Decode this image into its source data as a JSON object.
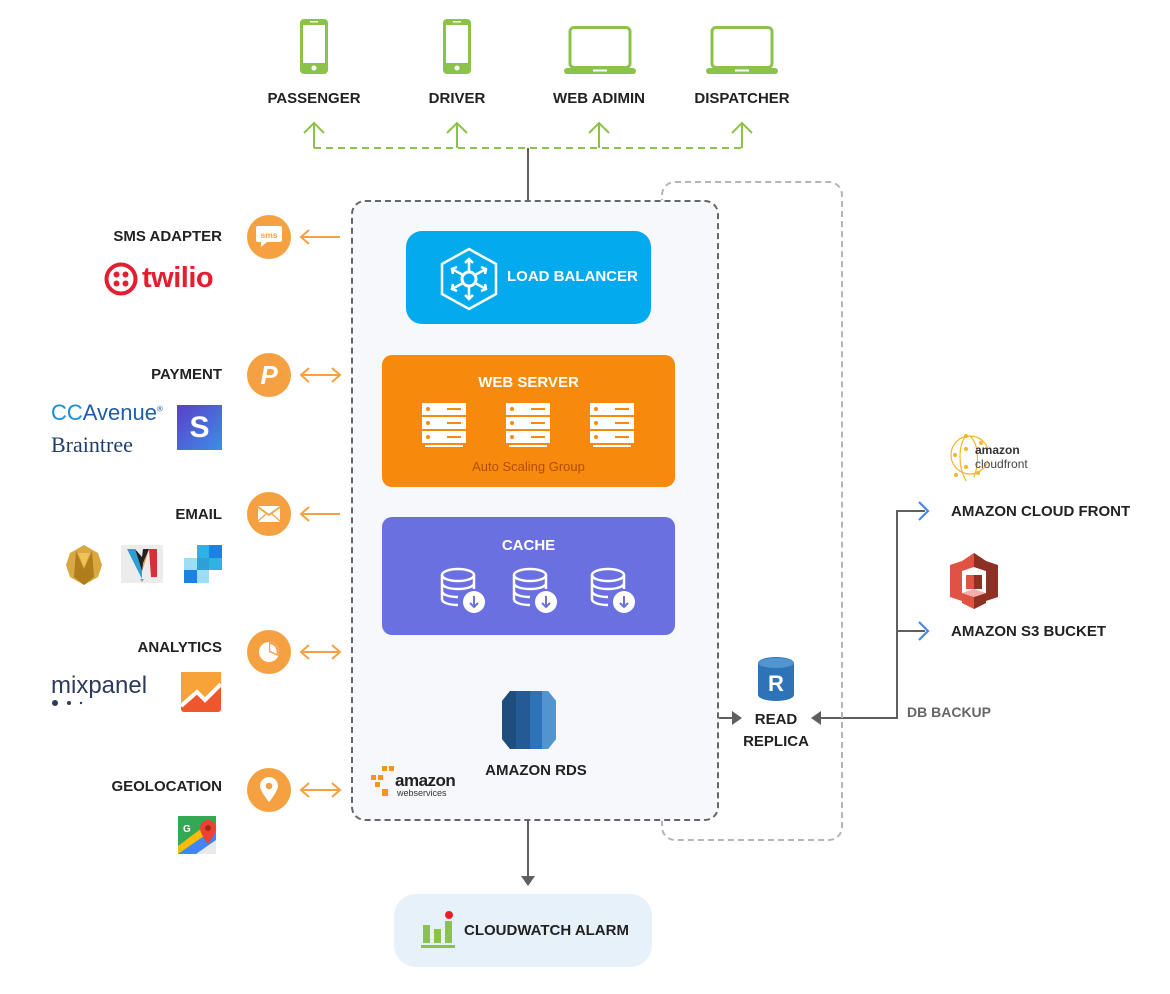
{
  "clients": [
    {
      "label": "PASSENGER",
      "icon": "smartphone-icon"
    },
    {
      "label": "DRIVER",
      "icon": "smartphone-icon"
    },
    {
      "label": "WEB ADIMIN",
      "icon": "laptop-icon"
    },
    {
      "label": "DISPATCHER",
      "icon": "laptop-icon"
    }
  ],
  "external_services": [
    {
      "label": "SMS ADAPTER",
      "icon": "sms-icon",
      "direction": "inbound",
      "providers": [
        "twilio"
      ]
    },
    {
      "label": "PAYMENT",
      "icon": "paypal-icon",
      "direction": "bidirectional",
      "providers": [
        "CCAvenue",
        "Braintree",
        "Stripe"
      ]
    },
    {
      "label": "EMAIL",
      "icon": "envelope-icon",
      "direction": "inbound",
      "providers": [
        "Amazon SES",
        "Mandrill",
        "SendGrid"
      ]
    },
    {
      "label": "ANALYTICS",
      "icon": "pie-chart-icon",
      "direction": "bidirectional",
      "providers": [
        "mixpanel",
        "Google Analytics"
      ]
    },
    {
      "label": "GEOLOCATION",
      "icon": "location-pin-icon",
      "direction": "bidirectional",
      "providers": [
        "Google Maps"
      ]
    }
  ],
  "logos": {
    "twilio": "twilio",
    "ccavenue_cc": "CC",
    "ccavenue_rest": "Avenue",
    "braintree": "Braintree",
    "stripe": "S",
    "mixpanel": "mixpanel",
    "aws_line1": "amazon",
    "aws_line2": "webservices",
    "cloudfront_line1": "amazon",
    "cloudfront_line2": "cloudfront",
    "sms_text": "sms",
    "replica_letter": "R",
    "maps_letter": "G"
  },
  "core": {
    "load_balancer": "LOAD BALANCER",
    "web_server": "WEB SERVER",
    "auto_scaling": "Auto Scaling Group",
    "cache": "CACHE",
    "rds": "AMAZON RDS",
    "read_replica_line1": "READ",
    "read_replica_line2": "REPLICA",
    "cloudwatch": "CLOUDWATCH ALARM"
  },
  "backup": {
    "label": "DB BACKUP",
    "targets": [
      "AMAZON CLOUD FRONT",
      "AMAZON S3 BUCKET"
    ]
  },
  "colors": {
    "client_green": "#8bc34a",
    "service_orange": "#f5a142",
    "load_balancer": "#03aaee",
    "web_server": "#f7890c",
    "cache": "#6a70e0",
    "connector_gray": "#5f5f5f",
    "backup_arrow_blue": "#4a86e8",
    "cloudwatch_bg": "#e6f1f9"
  }
}
